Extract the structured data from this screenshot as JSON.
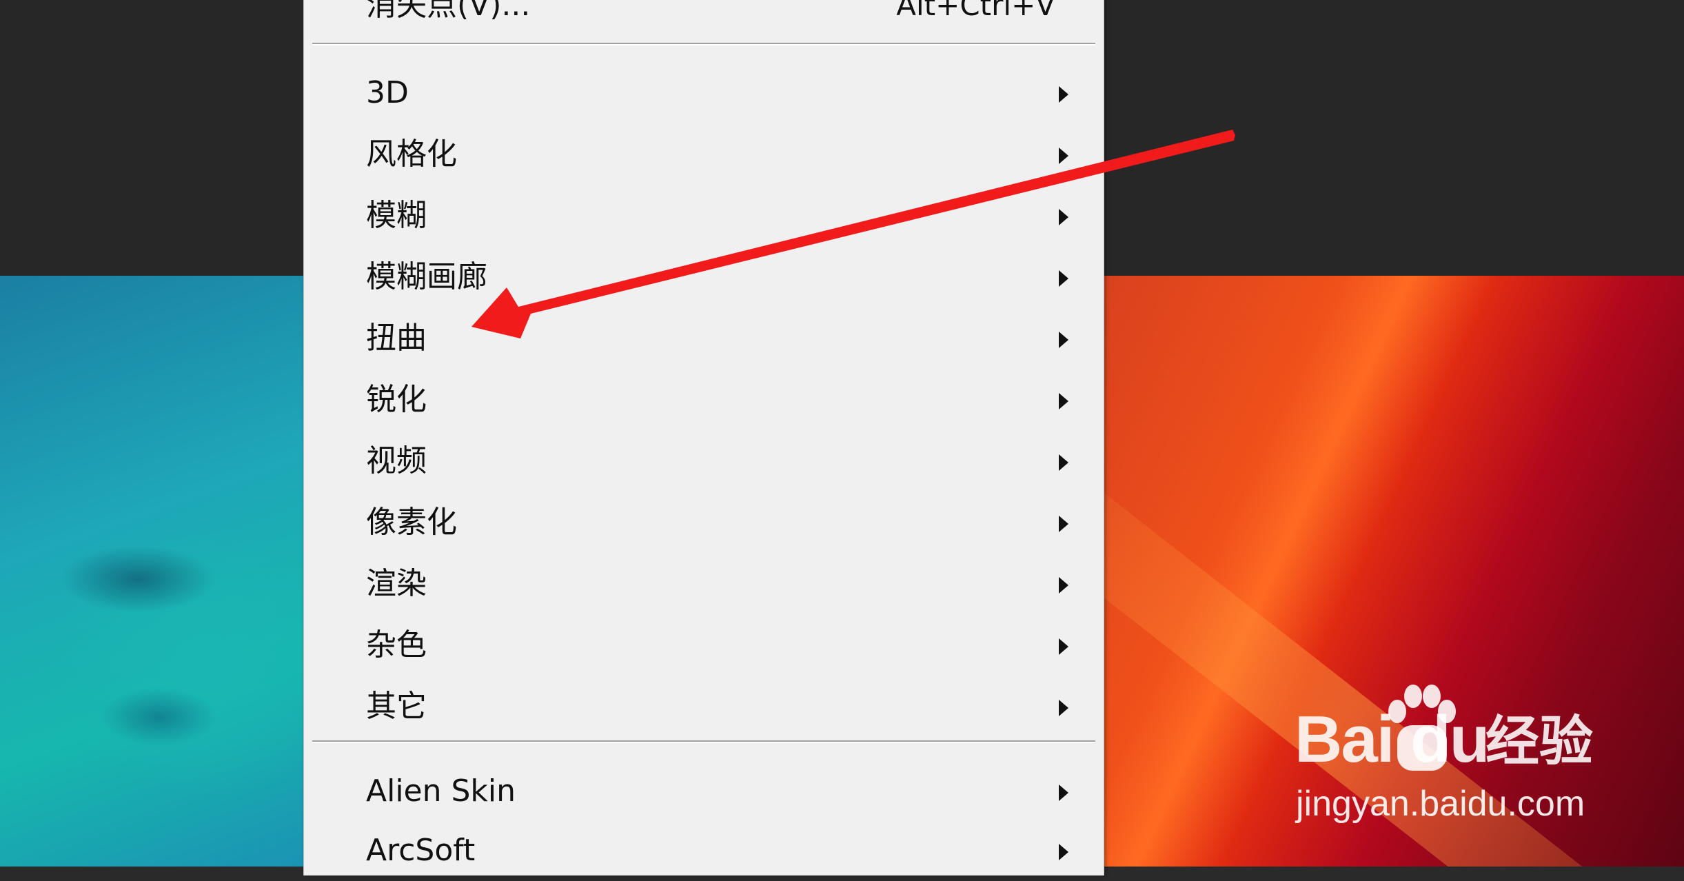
{
  "menu": {
    "top_item": {
      "label": "消失点(V)...",
      "shortcut": "Alt+Ctrl+V"
    },
    "filter_items": [
      {
        "label": "3D",
        "icon": "chevron-right-icon"
      },
      {
        "label": "风格化",
        "icon": "chevron-right-icon"
      },
      {
        "label": "模糊",
        "icon": "chevron-right-icon"
      },
      {
        "label": "模糊画廊",
        "icon": "chevron-right-icon"
      },
      {
        "label": "扭曲",
        "icon": "chevron-right-icon"
      },
      {
        "label": "锐化",
        "icon": "chevron-right-icon"
      },
      {
        "label": "视频",
        "icon": "chevron-right-icon"
      },
      {
        "label": "像素化",
        "icon": "chevron-right-icon"
      },
      {
        "label": "渲染",
        "icon": "chevron-right-icon"
      },
      {
        "label": "杂色",
        "icon": "chevron-right-icon"
      },
      {
        "label": "其它",
        "icon": "chevron-right-icon"
      }
    ],
    "plugin_items": [
      {
        "label": "Alien Skin",
        "icon": "chevron-right-icon"
      },
      {
        "label": "ArcSoft",
        "icon": "chevron-right-icon"
      }
    ]
  },
  "annotation": {
    "color": "#f11b1b",
    "points_to": "扭曲"
  },
  "watermark": {
    "logo_text": "Bai du",
    "brand_text": "经验",
    "url": "jingyan.baidu.com"
  },
  "colors": {
    "menu_bg": "#f0f0f0",
    "canvas_dark": "#272727",
    "arrow_red": "#f11b1b"
  }
}
